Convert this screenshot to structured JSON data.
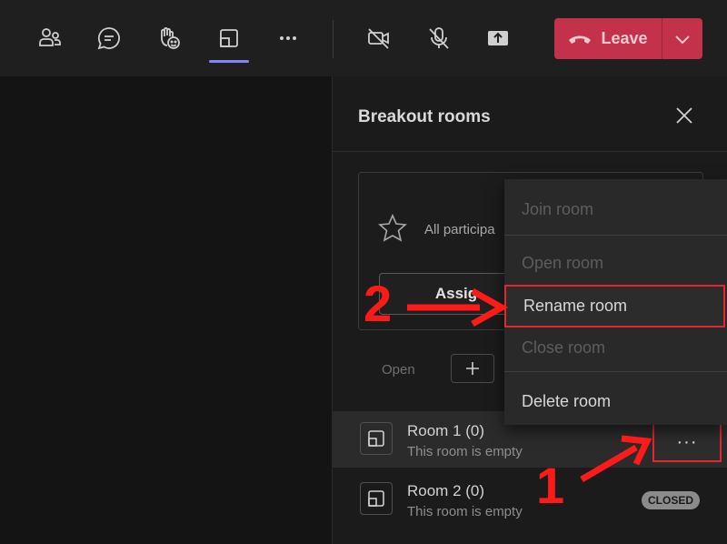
{
  "toolbar": {
    "buttons": [
      {
        "icon": "people-icon"
      },
      {
        "icon": "chat-icon"
      },
      {
        "icon": "react-icon"
      },
      {
        "icon": "breakout-rooms-icon",
        "active": true
      },
      {
        "icon": "more-icon"
      },
      {
        "icon": "camera-off-icon"
      },
      {
        "icon": "mic-off-icon"
      },
      {
        "icon": "share-icon"
      }
    ],
    "leave_label": "Leave",
    "leave_color": "#c4314b",
    "active_indicator_color": "#7f85f5"
  },
  "panel": {
    "title": "Breakout rooms",
    "assign_text": "All participa",
    "assign_button": "Assig",
    "open_label": "Open",
    "rooms": [
      {
        "name": "Room 1  (0)",
        "status": "This room is empty",
        "more": "···"
      },
      {
        "name": "Room 2  (0)",
        "status": "This room is empty",
        "badge": "CLOSED"
      }
    ]
  },
  "context_menu": {
    "items": [
      {
        "label": "Join room",
        "enabled": false
      },
      {
        "label": "Open room",
        "enabled": false
      },
      {
        "label": "Rename room",
        "enabled": true,
        "highlighted": true
      },
      {
        "label": "Close room",
        "enabled": false
      },
      {
        "label": "Delete room",
        "enabled": true
      }
    ]
  },
  "annotations": {
    "step1": "1",
    "step2": "2",
    "color": "#ff1a1a"
  }
}
